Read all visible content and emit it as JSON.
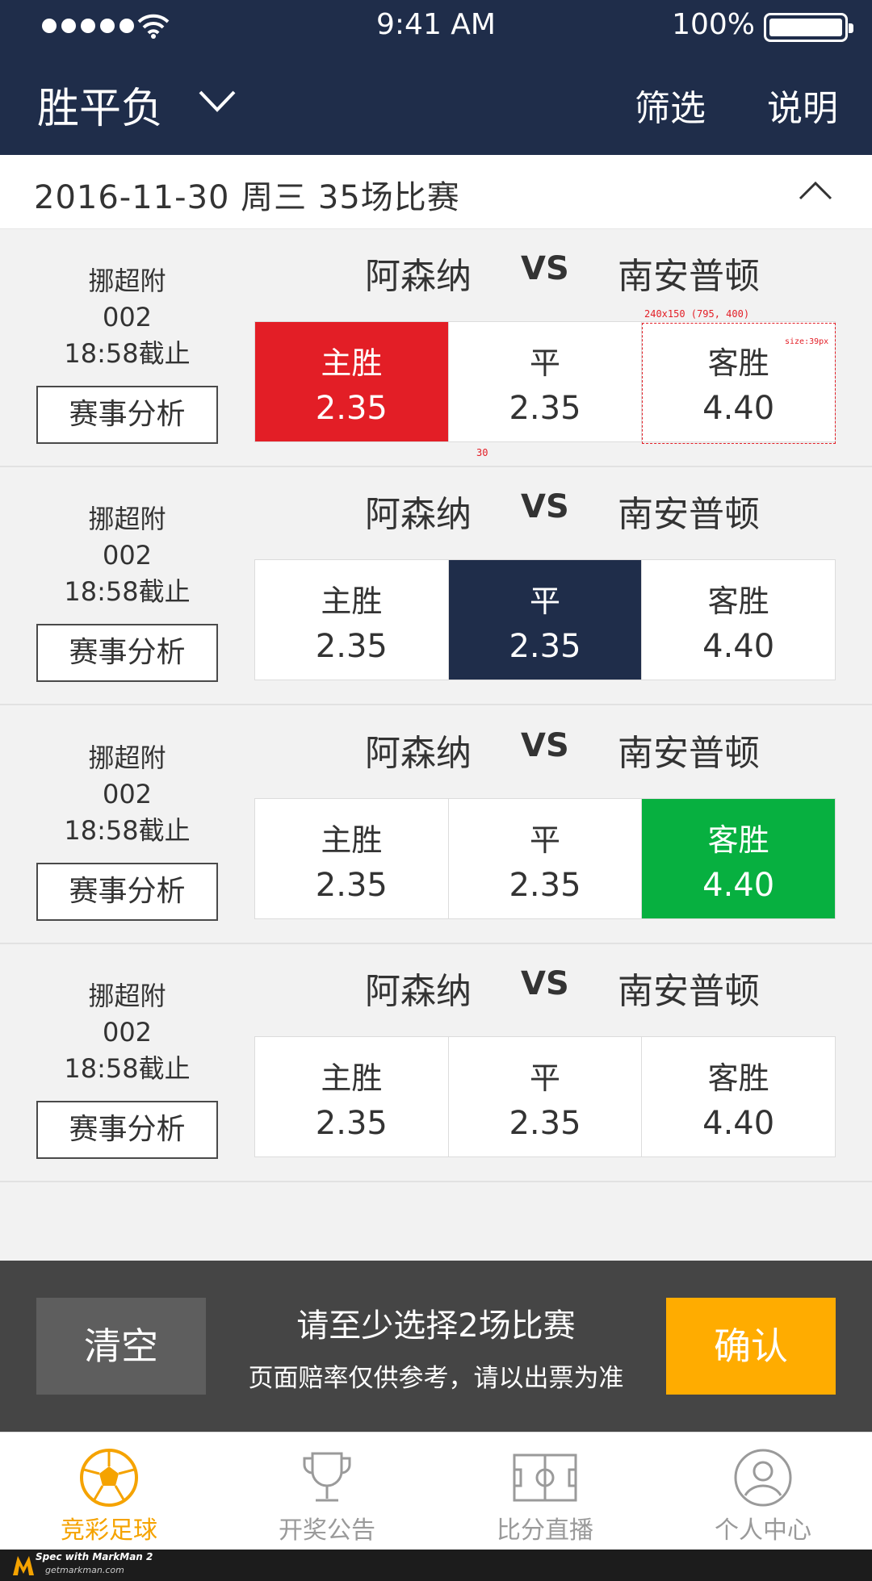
{
  "status": {
    "time": "9:41 AM",
    "battery": "100%"
  },
  "nav": {
    "title": "胜平负",
    "filter": "筛选",
    "explain": "说明"
  },
  "datebar": {
    "text": "2016-11-30   周三   35场比赛"
  },
  "matches": [
    {
      "league": "挪超附",
      "code": "002",
      "deadline": "18:58截止",
      "analysis": "赛事分析",
      "home": "阿森纳",
      "vs": "VS",
      "away": "南安普顿",
      "odds": [
        {
          "label": "主胜",
          "value": "2.35"
        },
        {
          "label": "平",
          "value": "2.35"
        },
        {
          "label": "客胜",
          "value": "4.40"
        }
      ],
      "selected": 0
    },
    {
      "league": "挪超附",
      "code": "002",
      "deadline": "18:58截止",
      "analysis": "赛事分析",
      "home": "阿森纳",
      "vs": "VS",
      "away": "南安普顿",
      "odds": [
        {
          "label": "主胜",
          "value": "2.35"
        },
        {
          "label": "平",
          "value": "2.35"
        },
        {
          "label": "客胜",
          "value": "4.40"
        }
      ],
      "selected": 1
    },
    {
      "league": "挪超附",
      "code": "002",
      "deadline": "18:58截止",
      "analysis": "赛事分析",
      "home": "阿森纳",
      "vs": "VS",
      "away": "南安普顿",
      "odds": [
        {
          "label": "主胜",
          "value": "2.35"
        },
        {
          "label": "平",
          "value": "2.35"
        },
        {
          "label": "客胜",
          "value": "4.40"
        }
      ],
      "selected": 2
    },
    {
      "league": "挪超附",
      "code": "002",
      "deadline": "18:58截止",
      "analysis": "赛事分析",
      "home": "阿森纳",
      "vs": "VS",
      "away": "南安普顿",
      "odds": [
        {
          "label": "主胜",
          "value": "2.35"
        },
        {
          "label": "平",
          "value": "2.35"
        },
        {
          "label": "客胜",
          "value": "4.40"
        }
      ],
      "selected": null
    }
  ],
  "annotations": {
    "box": "240x150 (795, 400)",
    "size": "size:39px",
    "gap": "30"
  },
  "action": {
    "clear": "清空",
    "msg1": "请至少选择2场比赛",
    "msg2": "页面赔率仅供参考，请以出票为准",
    "confirm": "确认"
  },
  "tabs": [
    {
      "label": "竞彩足球",
      "icon": "soccer-ball-icon"
    },
    {
      "label": "开奖公告",
      "icon": "trophy-icon"
    },
    {
      "label": "比分直播",
      "icon": "soccer-field-icon"
    },
    {
      "label": "个人中心",
      "icon": "user-icon"
    }
  ],
  "footer": {
    "spec": "Spec with MarkMan 2",
    "url": "getmarkman.com"
  },
  "colors": {
    "nav": "#1f2d4a",
    "red": "#e31e26",
    "green": "#07b040",
    "orange": "#ffac00",
    "actionbar": "#454545"
  }
}
